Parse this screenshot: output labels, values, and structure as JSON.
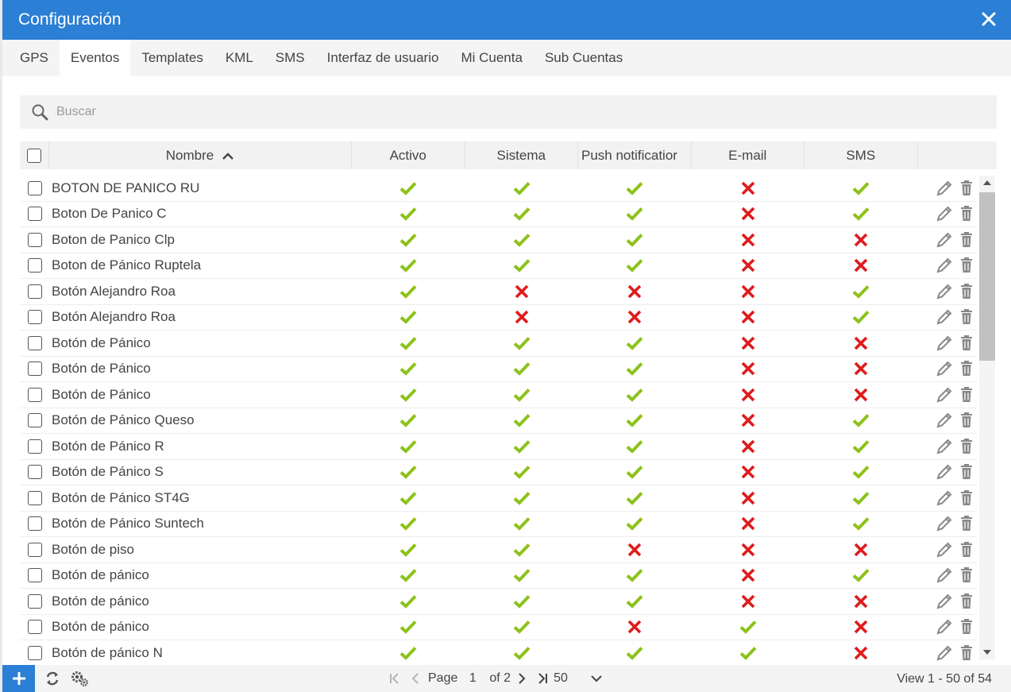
{
  "window": {
    "title": "Configuración"
  },
  "tabs": [
    {
      "label": "GPS",
      "active": false
    },
    {
      "label": "Eventos",
      "active": true
    },
    {
      "label": "Templates",
      "active": false
    },
    {
      "label": "KML",
      "active": false
    },
    {
      "label": "SMS",
      "active": false
    },
    {
      "label": "Interfaz de usuario",
      "active": false
    },
    {
      "label": "Mi Cuenta",
      "active": false
    },
    {
      "label": "Sub Cuentas",
      "active": false
    }
  ],
  "search": {
    "placeholder": "Buscar"
  },
  "columns": {
    "nombre": "Nombre",
    "activo": "Activo",
    "sistema": "Sistema",
    "push": "Push notificatior",
    "email": "E-mail",
    "sms": "SMS"
  },
  "colors": {
    "titlebar": "#2b7fd4",
    "check": "#8cc21a",
    "cross": "#e01b1b",
    "action_icon": "#888888"
  },
  "icons": {
    "check": "checkmark-icon",
    "cross": "cross-icon",
    "edit": "pencil-icon",
    "delete": "trash-icon"
  },
  "rows": [
    {
      "name": "BOTON DE PANICO RU",
      "activo": true,
      "sistema": true,
      "push": true,
      "email": false,
      "sms": true
    },
    {
      "name": "Boton De Panico C",
      "activo": true,
      "sistema": true,
      "push": true,
      "email": false,
      "sms": true
    },
    {
      "name": "Boton de Panico Clp",
      "activo": true,
      "sistema": true,
      "push": true,
      "email": false,
      "sms": false
    },
    {
      "name": "Boton de Pánico Ruptela",
      "activo": true,
      "sistema": true,
      "push": true,
      "email": false,
      "sms": false
    },
    {
      "name": "Botón Alejandro Roa",
      "activo": true,
      "sistema": false,
      "push": false,
      "email": false,
      "sms": true
    },
    {
      "name": "Botón Alejandro Roa",
      "activo": true,
      "sistema": false,
      "push": false,
      "email": false,
      "sms": true
    },
    {
      "name": "Botón de Pánico",
      "activo": true,
      "sistema": true,
      "push": true,
      "email": false,
      "sms": false
    },
    {
      "name": "Botón de Pánico",
      "activo": true,
      "sistema": true,
      "push": true,
      "email": false,
      "sms": false
    },
    {
      "name": "Botón de Pánico",
      "activo": true,
      "sistema": true,
      "push": true,
      "email": false,
      "sms": false
    },
    {
      "name": "Botón de Pánico Queso",
      "activo": true,
      "sistema": true,
      "push": true,
      "email": false,
      "sms": true
    },
    {
      "name": "Botón de Pánico R",
      "activo": true,
      "sistema": true,
      "push": true,
      "email": false,
      "sms": true
    },
    {
      "name": "Botón de Pánico S",
      "activo": true,
      "sistema": true,
      "push": true,
      "email": false,
      "sms": true
    },
    {
      "name": "Botón de Pánico ST4G",
      "activo": true,
      "sistema": true,
      "push": true,
      "email": false,
      "sms": true
    },
    {
      "name": "Botón de Pánico Suntech",
      "activo": true,
      "sistema": true,
      "push": true,
      "email": false,
      "sms": true
    },
    {
      "name": "Botón de piso",
      "activo": true,
      "sistema": true,
      "push": false,
      "email": false,
      "sms": false
    },
    {
      "name": "Botón de pánico",
      "activo": true,
      "sistema": true,
      "push": true,
      "email": false,
      "sms": true
    },
    {
      "name": "Botón de pánico",
      "activo": true,
      "sistema": true,
      "push": true,
      "email": false,
      "sms": false
    },
    {
      "name": "Botón de pánico",
      "activo": true,
      "sistema": true,
      "push": false,
      "email": true,
      "sms": false
    },
    {
      "name": "Botón de pánico N",
      "activo": true,
      "sistema": true,
      "push": true,
      "email": true,
      "sms": false
    }
  ],
  "pager": {
    "page_label": "Page",
    "page_value": "1",
    "of_label": "of 2",
    "page_size": "50",
    "view_info": "View 1 - 50 of 54"
  }
}
